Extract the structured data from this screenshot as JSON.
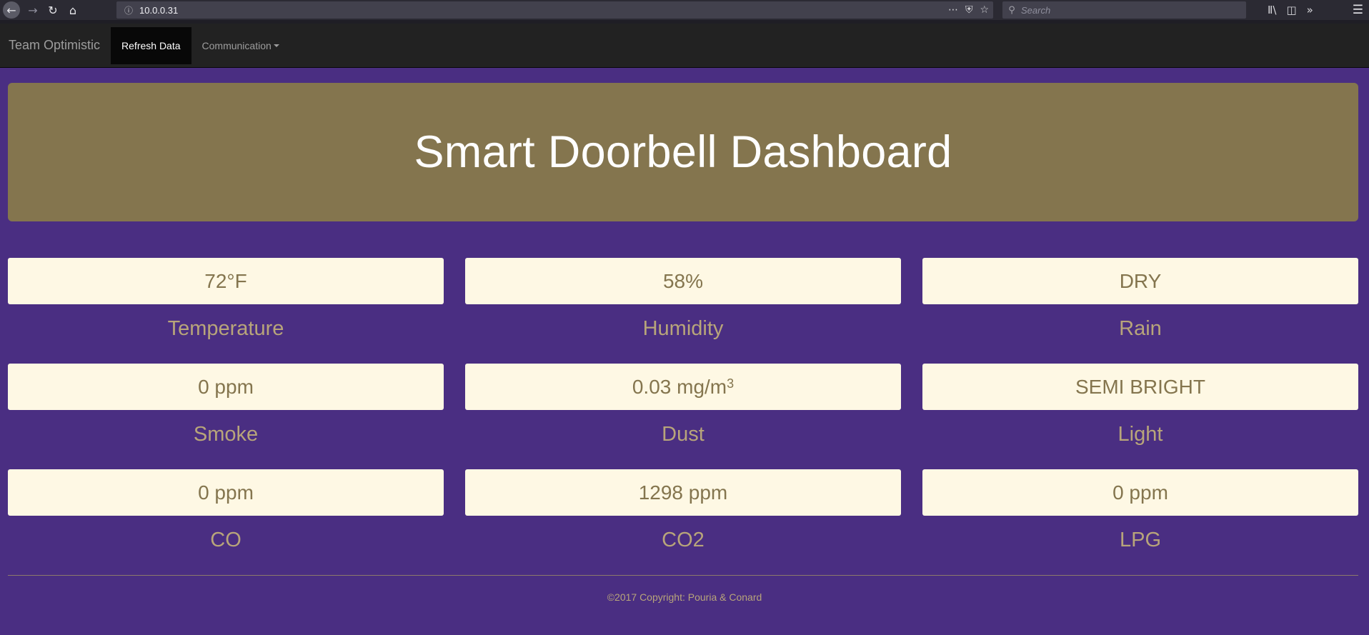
{
  "browser": {
    "url": "10.0.0.31",
    "search_placeholder": "Search",
    "icons": {
      "back": "back-arrow-icon",
      "forward": "forward-arrow-icon",
      "reload": "reload-icon",
      "home": "home-icon",
      "info": "info-icon",
      "more": "ellipsis-icon",
      "pocket": "pocket-icon",
      "bookmark": "star-icon",
      "search": "search-icon",
      "library": "library-icon",
      "sidebar": "sidebar-icon",
      "overflow": "chevrons-right-icon",
      "menu": "hamburger-menu-icon"
    }
  },
  "navbar": {
    "brand": "Team Optimistic",
    "items": [
      {
        "label": "Refresh Data",
        "active": true
      },
      {
        "label": "Communication",
        "dropdown": true
      }
    ]
  },
  "jumbotron": {
    "title": "Smart Doorbell Dashboard"
  },
  "sensors": {
    "rows": [
      [
        {
          "value": "72°F",
          "label": "Temperature"
        },
        {
          "value": "58%",
          "label": "Humidity"
        },
        {
          "value": "DRY",
          "label": "Rain"
        }
      ],
      [
        {
          "value": "0 ppm",
          "label": "Smoke"
        },
        {
          "value": "0.03 mg/m",
          "unit_superscript": "3",
          "label": "Dust"
        },
        {
          "value": "SEMI BRIGHT",
          "label": "Light"
        }
      ],
      [
        {
          "value": "0 ppm",
          "label": "CO"
        },
        {
          "value": "1298 ppm",
          "label": "CO2"
        },
        {
          "value": "0 ppm",
          "label": "LPG"
        }
      ]
    ]
  },
  "footer": {
    "text": "©2017 Copyright: Pouria & Conard"
  },
  "colors": {
    "page_background": "#4a2e82",
    "jumbotron_background": "#84754e",
    "value_box_background": "#fef8e4",
    "value_text": "#84754e",
    "label_text": "#b8a57a",
    "navbar_background": "#222222"
  }
}
